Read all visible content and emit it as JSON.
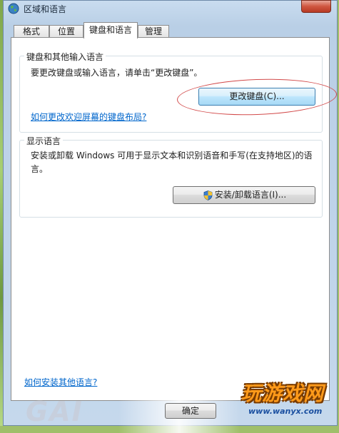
{
  "window": {
    "title": "区域和语言"
  },
  "tabs": [
    {
      "label": "格式"
    },
    {
      "label": "位置"
    },
    {
      "label": "键盘和语言"
    },
    {
      "label": "管理"
    }
  ],
  "keyboard_group": {
    "legend": "键盘和其他输入语言",
    "instruction": "要更改键盘或输入语言，请单击“更改键盘”。",
    "change_keyboard_button": "更改键盘(C)...",
    "welcome_screen_link": "如何更改欢迎屏幕的键盘布局?"
  },
  "display_group": {
    "legend": "显示语言",
    "description_line1": "安装或卸载 Windows 可用于显示文本和识别语音和手写(在支持地区)的语",
    "description_line2": "言。",
    "install_button": "安装/卸载语言(I)..."
  },
  "footer": {
    "install_other_link": "如何安装其他语言?",
    "ok_button": "确定"
  },
  "watermark": {
    "text": "GAI"
  },
  "site_logo": {
    "name": "玩游戏网",
    "url": "www.wanyx.com"
  },
  "colors": {
    "link": "#0066cc",
    "annotation_ellipse": "#d24a4a"
  }
}
